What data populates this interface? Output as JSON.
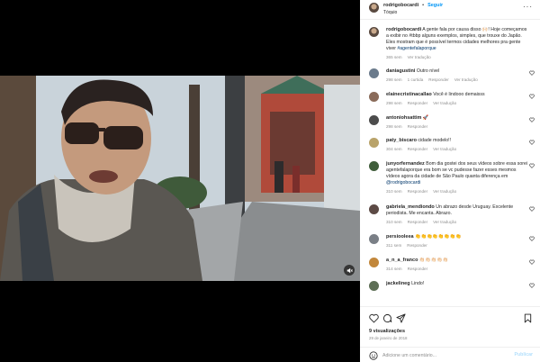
{
  "post": {
    "username": "rodrigobocardi",
    "follow_label": "Seguir",
    "separator": "•",
    "location": "Tóquio",
    "caption_text": "A gente fala por causa disso 🙌🏻! Hoje começamos a exibir no #tbbp alguns exemplos, simples, que trouxe do Japão. Eles mostram que é possível termos cidades melhores pra gente viver ",
    "caption_hashtag": "#agentefalaporque",
    "caption_time": "365 sem",
    "caption_translate": "Ver tradução"
  },
  "comments": [
    {
      "user": "daniagustini",
      "text": "Outro nível",
      "time": "298 sem",
      "likes": "1 curtida",
      "reply": "Responder",
      "translate": "Ver tradução"
    },
    {
      "user": "elainecristinacallao",
      "text": "Você é lindooo demaisss",
      "time": "298 sem",
      "likes": "",
      "reply": "Responder",
      "translate": "Ver tradução"
    },
    {
      "user": "antoniohsattim",
      "text": "🚀",
      "time": "298 sem",
      "likes": "",
      "reply": "Responder",
      "translate": ""
    },
    {
      "user": "paty_biscaro",
      "text": "cidade modelo!!",
      "time": "304 sem",
      "likes": "",
      "reply": "Responder",
      "translate": "Ver tradução"
    },
    {
      "user": "junyorfernandez",
      "text": "Bom dia gostei dos seus vídeos sobre essa sorei agentefalaporque era bom se vc pudesse fazer esses mesmos vídeos agora da cidade de São Paulo quanta diferença em ",
      "mention": "@rodrigobocardi",
      "time": "310 sem",
      "likes": "",
      "reply": "Responder",
      "translate": "Ver tradução"
    },
    {
      "user": "gabriela_mendiondo",
      "text": "Un abrazo desde Uruguay. Excelente periodista. Me encanta. Abrazo.",
      "time": "310 sem",
      "likes": "",
      "reply": "Responder",
      "translate": "Ver tradução"
    },
    {
      "user": "persiooleea",
      "text": "👏👏👏👏👏👏👏👏",
      "time": "311 sem",
      "likes": "",
      "reply": "Responder",
      "translate": ""
    },
    {
      "user": "a_n_a_franco",
      "text": "👏🏻👏🏻👏🏻👏🏻👏🏻",
      "time": "314 sem",
      "likes": "",
      "reply": "Responder",
      "translate": ""
    },
    {
      "user": "jackelineg",
      "text": "Lindo!",
      "time": "",
      "likes": "",
      "reply": "",
      "translate": ""
    }
  ],
  "footer": {
    "likes": "9 visualizações",
    "date": "29 de janeiro de 2018",
    "add_placeholder": "Adicione um comentário...",
    "publish": "Publicar"
  },
  "colors": {
    "accent": "#0095f6",
    "muted": "#8e8e8e",
    "text": "#262626"
  }
}
